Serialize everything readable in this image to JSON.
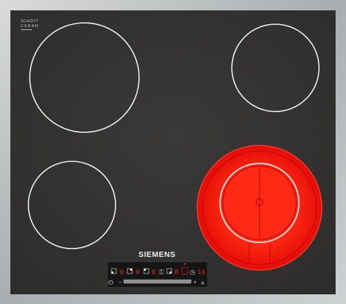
{
  "product": {
    "certification": {
      "lines": [
        "SCHOTT",
        "CERAN"
      ]
    },
    "brand": "SIEMENS"
  },
  "cooking_zones": [
    {
      "id": "front-left",
      "state": "off"
    },
    {
      "id": "rear-left",
      "state": "off"
    },
    {
      "id": "rear-right",
      "state": "off"
    },
    {
      "id": "front-right-dual",
      "state": "on",
      "color_on": "#ff1a10"
    }
  ],
  "control_panel": {
    "zone_levels": [
      "0",
      "0",
      "0",
      "0"
    ],
    "timer_readout": "14",
    "slider_minus": "−",
    "slider_plus": "+",
    "auto_label": "A",
    "power_symbol": "⏻",
    "lock_symbol": "⚿",
    "timer_symbol": "◷"
  },
  "colors": {
    "glass": "#333231",
    "frame": "#bfc2c3",
    "ring": "#f4f4f4",
    "heating": "#ff2412",
    "display": "#e0271b"
  }
}
